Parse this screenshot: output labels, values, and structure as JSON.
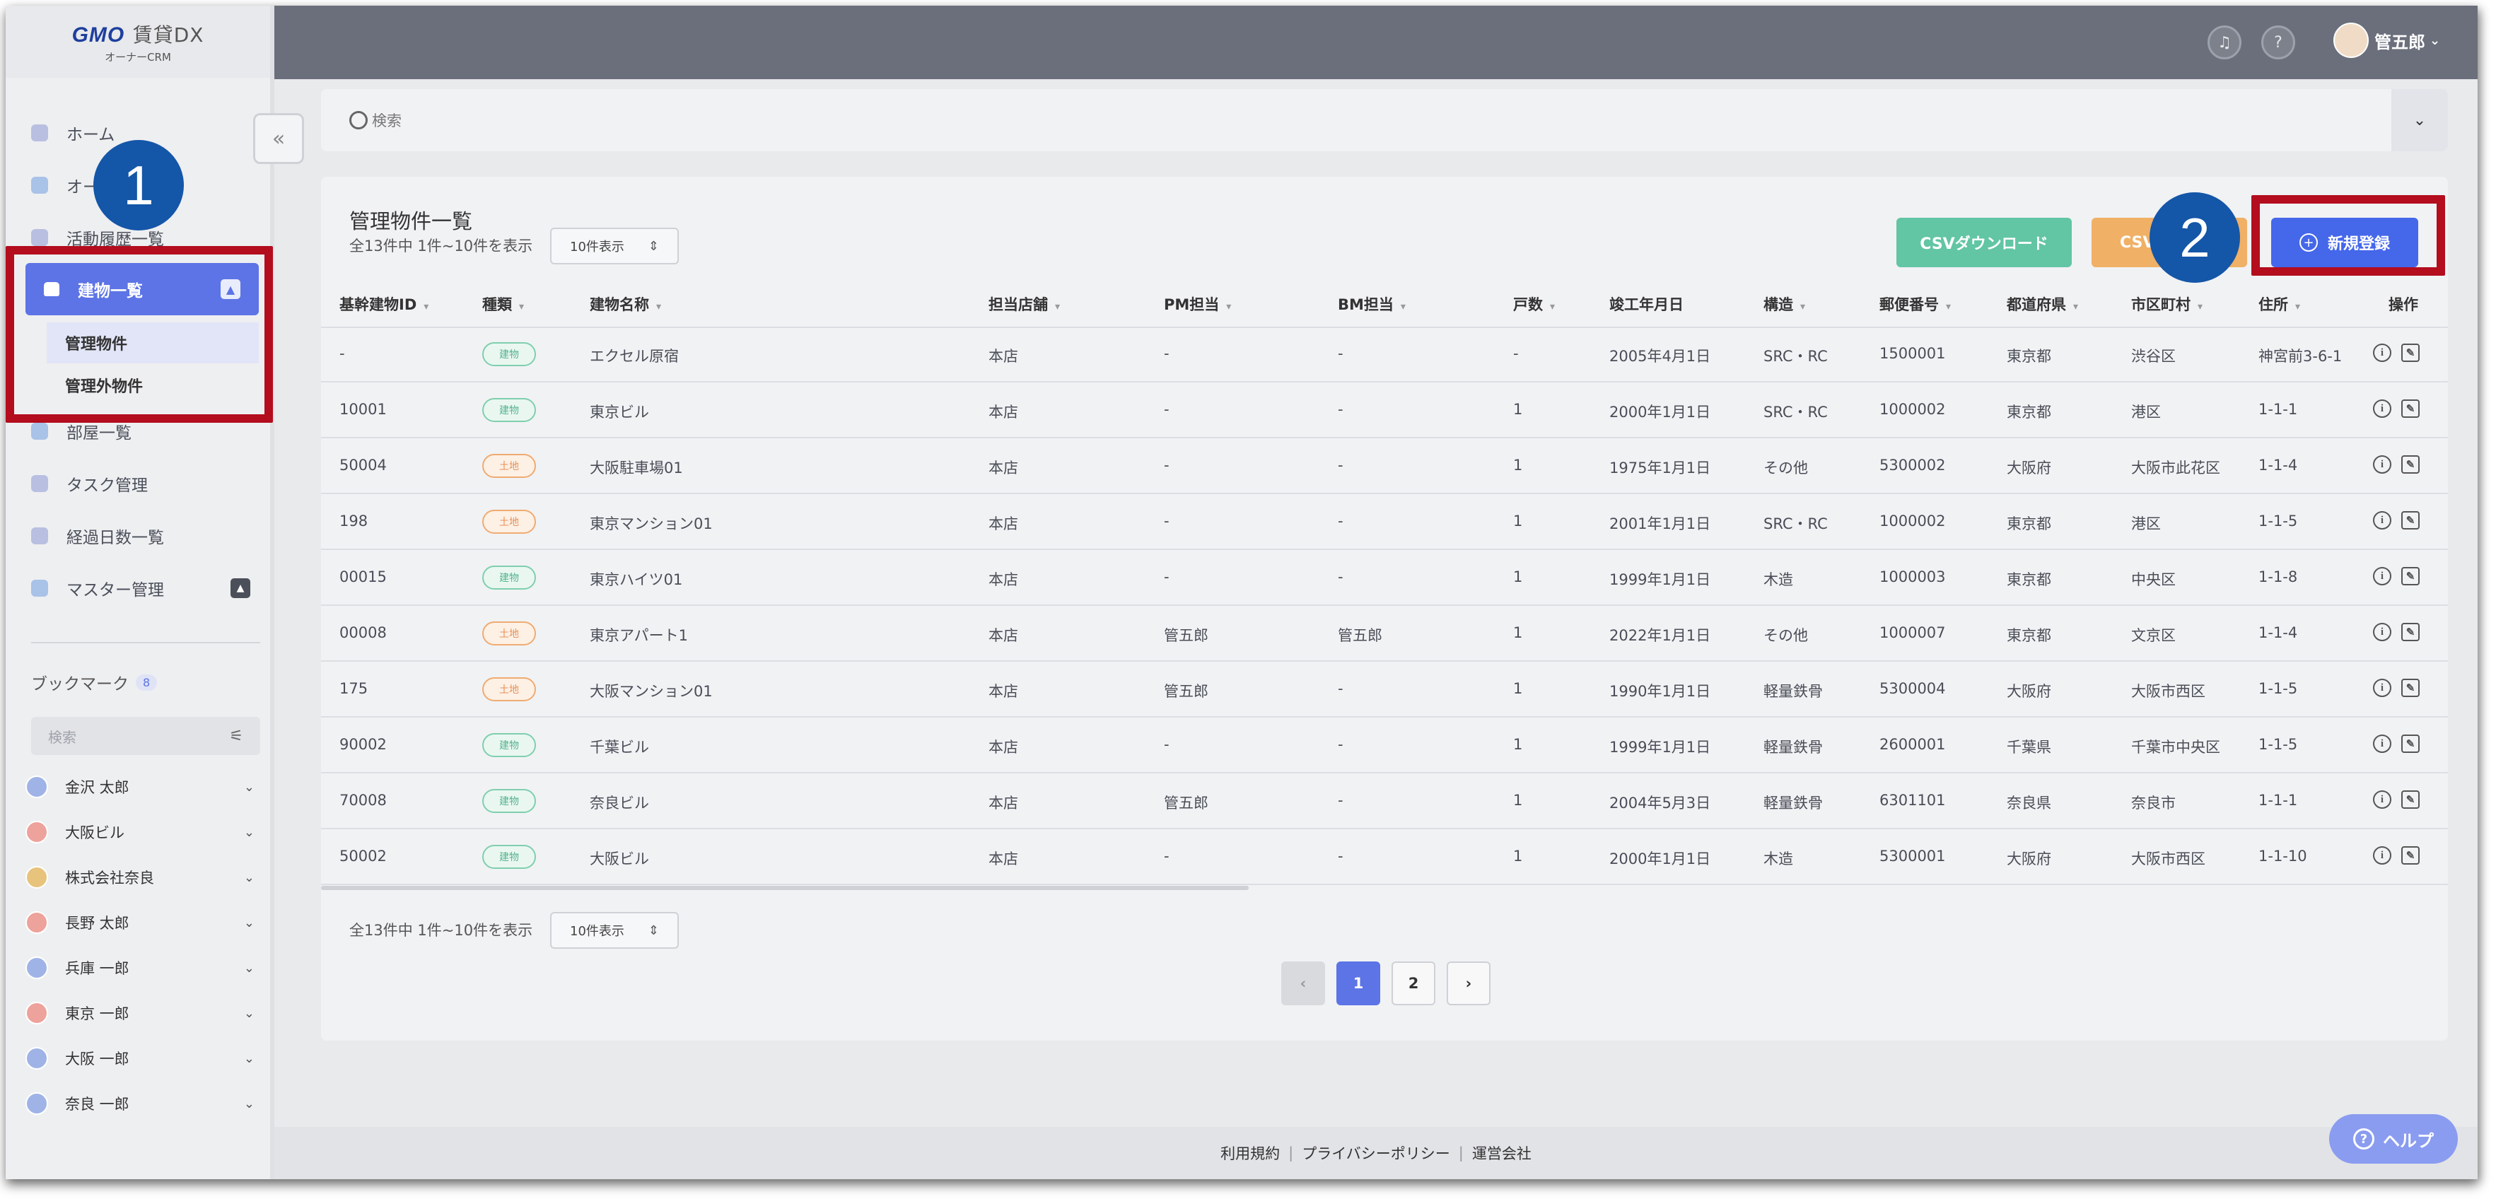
{
  "logo": {
    "brand": "GMO",
    "product": "賃貸DX",
    "sub": "オーナーCRM"
  },
  "nav": {
    "home": "ホーム",
    "owners": "オーナー一覧",
    "activity": "活動履歴一覧",
    "buildings": "建物一覧",
    "managed": "管理物件",
    "unmanaged": "管理外物件",
    "rooms": "部屋一覧",
    "tasks": "タスク管理",
    "elapsed": "経過日数一覧",
    "master": "マスター管理"
  },
  "bookmarks": {
    "title": "ブックマーク",
    "count": "8",
    "search_placeholder": "検索",
    "items": [
      "金沢 太郎",
      "大阪ビル",
      "株式会社奈良",
      "長野 太郎",
      "兵庫 一郎",
      "東京 一郎",
      "大阪 一郎",
      "奈良 一郎"
    ]
  },
  "header": {
    "user": "管五郎"
  },
  "search": {
    "placeholder": "検索"
  },
  "list": {
    "title": "管理物件一覧",
    "summary": "全13件中 1件~10件を表示",
    "per_page": "10件表示",
    "csv_download": "CSVダウンロード",
    "csv_upload": "CSV",
    "new_button": "新規登録",
    "columns": [
      "基幹建物ID",
      "種類",
      "建物名称",
      "担当店舗",
      "PM担当",
      "BM担当",
      "戸数",
      "竣工年月日",
      "構造",
      "郵便番号",
      "都道府県",
      "市区町村",
      "住所",
      "操作"
    ],
    "rows": [
      {
        "id": "-",
        "type": "建物",
        "kind": "bld",
        "name": "エクセル原宿",
        "store": "本店",
        "pm": "-",
        "bm": "-",
        "units": "-",
        "date": "2005年4月1日",
        "struct": "SRC・RC",
        "zip": "1500001",
        "pref": "東京都",
        "city": "渋谷区",
        "addr": "神宮前3-6-1("
      },
      {
        "id": "10001",
        "type": "建物",
        "kind": "bld",
        "name": "東京ビル",
        "store": "本店",
        "pm": "-",
        "bm": "-",
        "units": "1",
        "date": "2000年1月1日",
        "struct": "SRC・RC",
        "zip": "1000002",
        "pref": "東京都",
        "city": "港区",
        "addr": "1-1-1"
      },
      {
        "id": "50004",
        "type": "土地",
        "kind": "lnd",
        "name": "大阪駐車場01",
        "store": "本店",
        "pm": "-",
        "bm": "-",
        "units": "1",
        "date": "1975年1月1日",
        "struct": "その他",
        "zip": "5300002",
        "pref": "大阪府",
        "city": "大阪市此花区",
        "addr": "1-1-4"
      },
      {
        "id": "198",
        "type": "土地",
        "kind": "lnd",
        "name": "東京マンション01",
        "store": "本店",
        "pm": "-",
        "bm": "-",
        "units": "1",
        "date": "2001年1月1日",
        "struct": "SRC・RC",
        "zip": "1000002",
        "pref": "東京都",
        "city": "港区",
        "addr": "1-1-5"
      },
      {
        "id": "00015",
        "type": "建物",
        "kind": "bld",
        "name": "東京ハイツ01",
        "store": "本店",
        "pm": "-",
        "bm": "-",
        "units": "1",
        "date": "1999年1月1日",
        "struct": "木造",
        "zip": "1000003",
        "pref": "東京都",
        "city": "中央区",
        "addr": "1-1-8"
      },
      {
        "id": "00008",
        "type": "土地",
        "kind": "lnd",
        "name": "東京アパート1",
        "store": "本店",
        "pm": "管五郎",
        "bm": "管五郎",
        "units": "1",
        "date": "2022年1月1日",
        "struct": "その他",
        "zip": "1000007",
        "pref": "東京都",
        "city": "文京区",
        "addr": "1-1-4"
      },
      {
        "id": "175",
        "type": "土地",
        "kind": "lnd",
        "name": "大阪マンション01",
        "store": "本店",
        "pm": "管五郎",
        "bm": "-",
        "units": "1",
        "date": "1990年1月1日",
        "struct": "軽量鉄骨",
        "zip": "5300004",
        "pref": "大阪府",
        "city": "大阪市西区",
        "addr": "1-1-5"
      },
      {
        "id": "90002",
        "type": "建物",
        "kind": "bld",
        "name": "千葉ビル",
        "store": "本店",
        "pm": "-",
        "bm": "-",
        "units": "1",
        "date": "1999年1月1日",
        "struct": "軽量鉄骨",
        "zip": "2600001",
        "pref": "千葉県",
        "city": "千葉市中央区",
        "addr": "1-1-5"
      },
      {
        "id": "70008",
        "type": "建物",
        "kind": "bld",
        "name": "奈良ビル",
        "store": "本店",
        "pm": "管五郎",
        "bm": "-",
        "units": "1",
        "date": "2004年5月3日",
        "struct": "軽量鉄骨",
        "zip": "6301101",
        "pref": "奈良県",
        "city": "奈良市",
        "addr": "1-1-1"
      },
      {
        "id": "50002",
        "type": "建物",
        "kind": "bld",
        "name": "大阪ビル",
        "store": "本店",
        "pm": "-",
        "bm": "-",
        "units": "1",
        "date": "2000年1月1日",
        "struct": "木造",
        "zip": "5300001",
        "pref": "大阪府",
        "city": "大阪市西区",
        "addr": "1-1-10"
      }
    ],
    "pages": [
      "1",
      "2"
    ]
  },
  "footer": {
    "terms": "利用規約",
    "privacy": "プライバシーポリシー",
    "company": "運営会社"
  },
  "help": "ヘルプ",
  "callouts": {
    "one": "1",
    "two": "2"
  },
  "colors": {
    "accent": "#5d74e6",
    "primary_button": "#4567ea",
    "highlight": "#b30d1e",
    "callout": "#1456a8"
  }
}
